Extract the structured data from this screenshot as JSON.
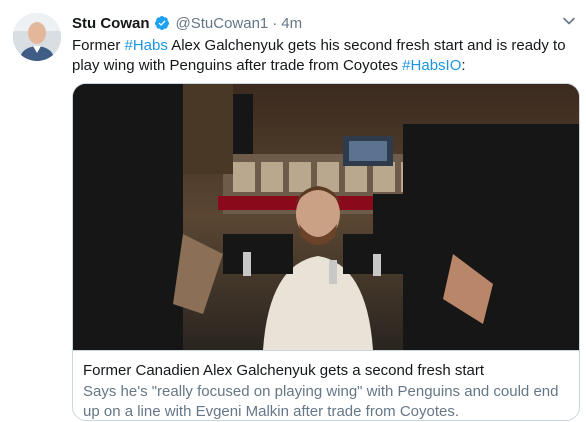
{
  "tweet": {
    "author": {
      "name": "Stu Cowan",
      "handle": "@StuCowan1",
      "verified": true
    },
    "separator": "·",
    "time": "4m",
    "text_parts": [
      "Former ",
      "#Habs",
      " Alex Galchenyuk gets his second fresh start and is ready to play wing with Penguins after trade from Coyotes ",
      "#HabsIO",
      ":"
    ],
    "card": {
      "title": "Former Canadien Alex Galchenyuk gets a second fresh start",
      "description": "Says he's \"really focused on playing wing\" with Penguins and could end up on a line with Evgeni Malkin after trade from Coyotes."
    }
  },
  "colors": {
    "text": "#14171a",
    "secondary": "#657786",
    "link": "#1b95e0",
    "verified": "#1da1f2",
    "border": "#ccd6dd"
  },
  "icons": {
    "verified": "verified-badge-icon",
    "caret": "chevron-down-icon"
  }
}
